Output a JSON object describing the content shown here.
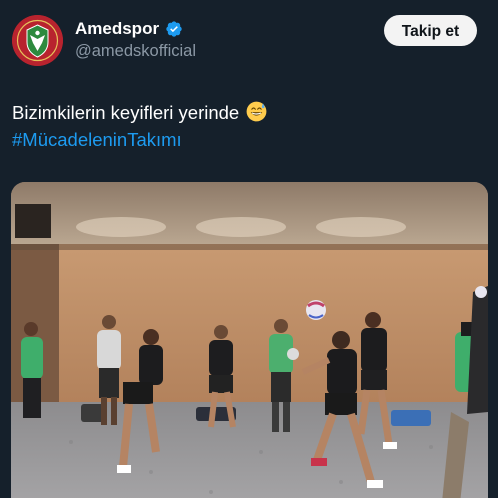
{
  "account": {
    "display_name": "Amedspor",
    "handle": "@amedskofficial",
    "verified": true,
    "avatar_icon": "amedspor-crest-icon",
    "avatar_color": "#b8232e"
  },
  "actions": {
    "follow_label": "Takip et"
  },
  "tweet": {
    "text": "Bizimkilerin keyifleri yerinde",
    "emoji": "grinning-face-with-sweat-icon",
    "hashtag": "#MücadeleninTakımı"
  },
  "media": {
    "type": "video",
    "scene": "players-playing-football-volley-in-locker-room"
  },
  "colors": {
    "background": "#15202b",
    "secondary_text": "#8b98a5",
    "link": "#1d9bf0",
    "verified": "#1d9bf0",
    "follow_button_bg": "#f3f3f3"
  }
}
